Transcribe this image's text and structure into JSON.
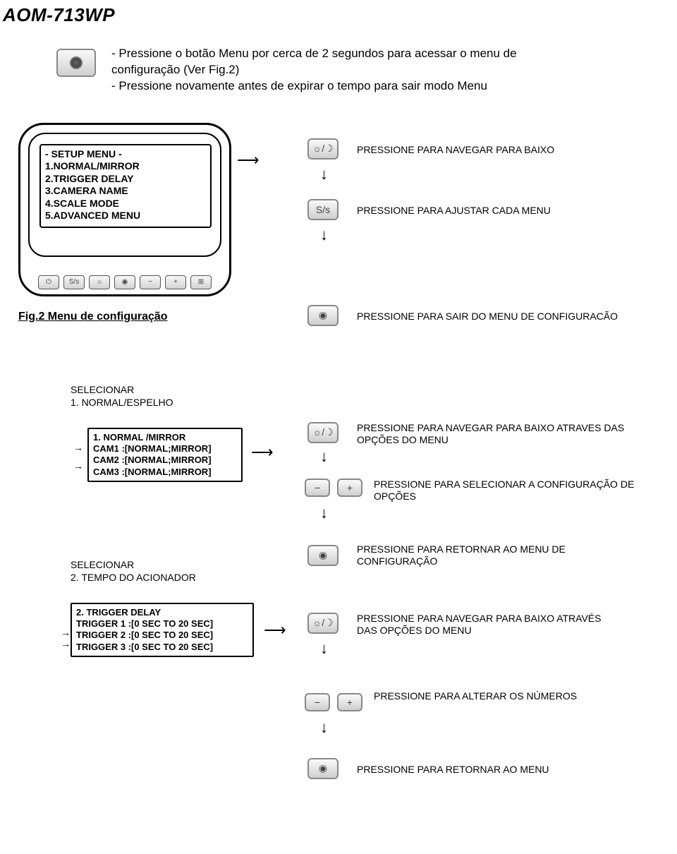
{
  "page_title": "AOM-713WP",
  "intro": {
    "line1": "- Pressione o botão Menu por cerca de 2 segundos para acessar o menu de configuração (Ver Fig.2)",
    "line2": "- Pressione novamente antes de expirar o tempo para sair modo Menu"
  },
  "setup_menu": {
    "header": "- SETUP MENU -",
    "items": [
      "1.NORMAL/MIRROR",
      "2.TRIGGER DELAY",
      "3.CAMERA NAME",
      "4.SCALE MODE",
      "5.ADVANCED MENU"
    ]
  },
  "fig_caption": "Fig.2 Menu de configuração",
  "legends": {
    "nav_down": "PRESSIONE PARA NAVEGAR PARA BAIXO",
    "adjust_menu": "PRESSIONE PARA AJUSTAR CADA MENU",
    "exit_config": "PRESSIONE PARA SAIR DO MENU DE CONFIGURACÃO",
    "sel_1_label": "SELECIONAR",
    "sel_1_item": "1. NORMAL/ESPELHO",
    "nm_title": "1. NORMAL /MIRROR",
    "nm_cam1": "CAM1 :[NORMAL;MIRROR]",
    "nm_cam2": "CAM2 :[NORMAL;MIRROR]",
    "nm_cam3": "CAM3 :[NORMAL;MIRROR]",
    "nav_options": "PRESSIONE PARA NAVEGAR PARA BAIXO ATRAVES DAS OPÇÕES DO MENU",
    "select_options": "PRESSIONE PARA SELECIONAR A CONFIGURAÇÃO DE OPÇÕES",
    "sel_2_label": "SELECIONAR",
    "sel_2_item": "2. TEMPO DO ACIONADOR",
    "return_config": "PRESSIONE PARA RETORNAR AO MENU DE CONFIGURAÇÃO",
    "td_title": "2. TRIGGER DELAY",
    "td_1": "TRIGGER 1 :[0 SEC TO 20 SEC]",
    "td_2": "TRIGGER 2 :[0 SEC TO 20 SEC]",
    "td_3": "TRIGGER 3 :[0 SEC TO 20 SEC]",
    "nav_options2": "PRESSIONE PARA NAVEGAR PARA BAIXO ATRAVÉS DAS OPÇÕES DO MENU",
    "change_numbers": "PRESSIONE PARA ALTERAR OS NÚMEROS",
    "return_menu": "PRESSIONE PARA RETORNAR AO MENU"
  },
  "icons": {
    "sun_moon": "☼/☽",
    "ss": "S/s",
    "power": "⏻",
    "minus": "−",
    "plus": "+"
  }
}
